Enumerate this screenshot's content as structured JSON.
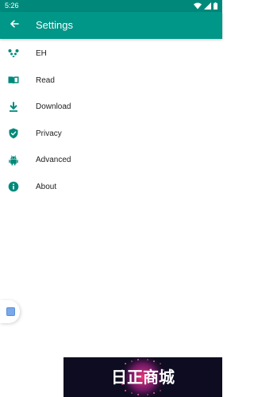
{
  "status_bar": {
    "time": "5:26",
    "icons": [
      "wifi-icon",
      "signal-icon",
      "battery-icon"
    ]
  },
  "app_bar": {
    "title": "Settings",
    "back_icon": "arrow-back-icon"
  },
  "settings": {
    "items": [
      {
        "label": "EH",
        "icon": "panda-icon"
      },
      {
        "label": "Read",
        "icon": "book-icon"
      },
      {
        "label": "Download",
        "icon": "download-icon"
      },
      {
        "label": "Privacy",
        "icon": "shield-icon"
      },
      {
        "label": "Advanced",
        "icon": "android-icon"
      },
      {
        "label": "About",
        "icon": "info-icon"
      }
    ]
  },
  "floating_tab": {
    "icon": "app-shortcut-icon"
  },
  "watermark": {
    "text": "日正商城"
  },
  "colors": {
    "primary": "#009688",
    "primary_dark": "#00897b",
    "icon_color": "#00897b",
    "background": "#ffffff",
    "text": "#212121"
  }
}
